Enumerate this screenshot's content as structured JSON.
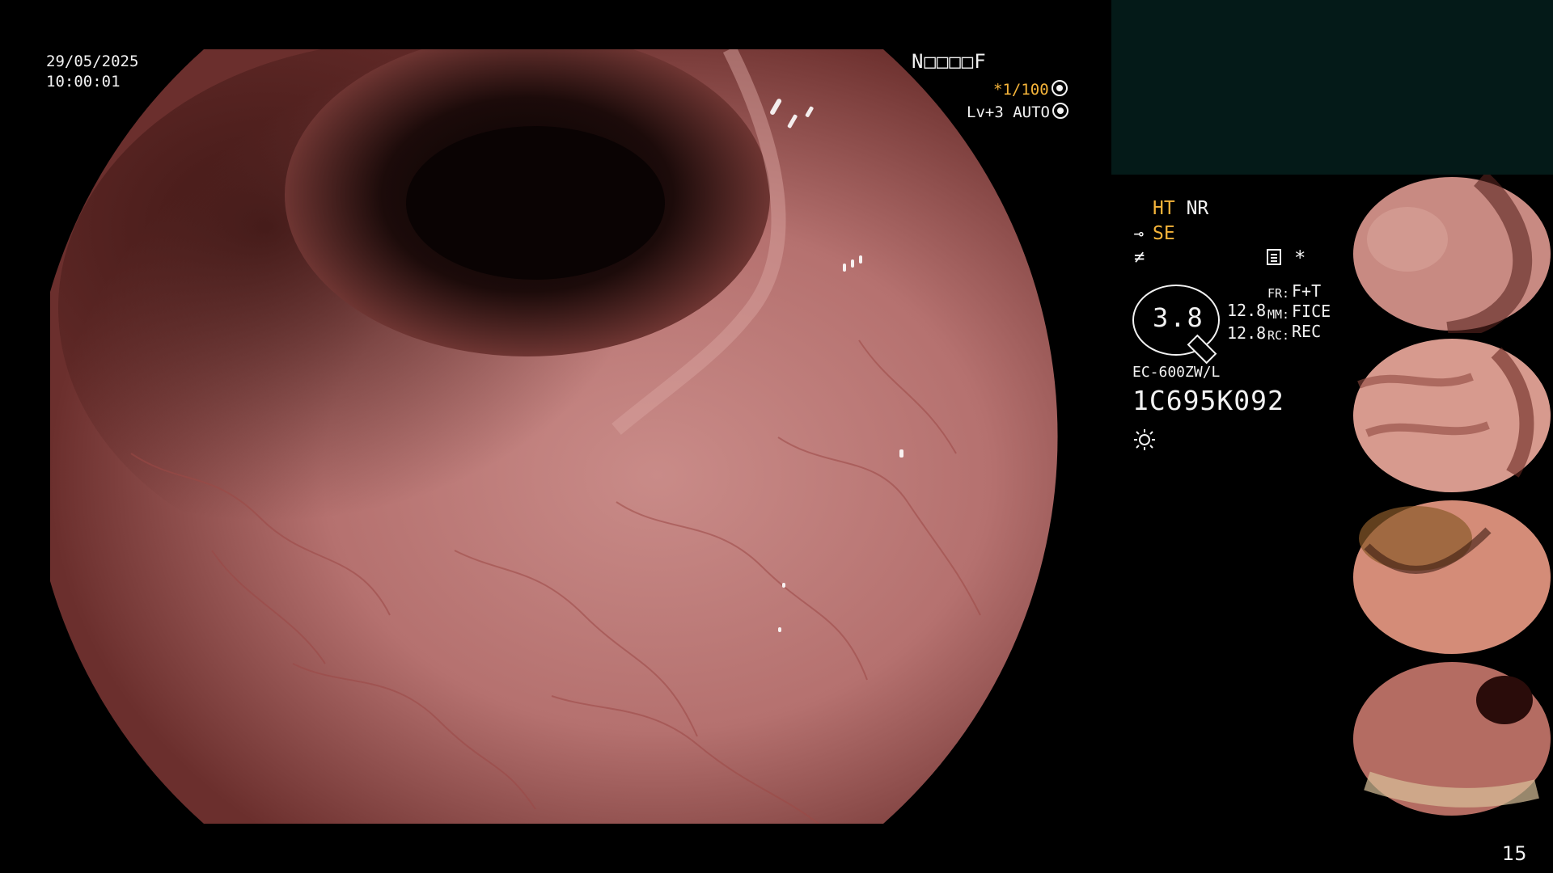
{
  "header": {
    "date": "29/05/2025",
    "time": "10:00:01",
    "patient_id": "N□□□□F",
    "shutter": "*1/100",
    "level": "Lv+3 AUTO"
  },
  "settings": {
    "ht_label": "HT",
    "nr_label": "NR",
    "se_label": "SE",
    "dial_value": "3.8",
    "fr_label": "FR:",
    "fr_value": "F+T",
    "mm_label": "MM:",
    "mm_value": "FICE",
    "rc_label": "RC:",
    "rc_value": "REC",
    "num_1": "12.8",
    "num_2": "12.8",
    "scope_model": "EC-600ZW/L",
    "serial": "1C695K092"
  },
  "footer": {
    "page_number": "15"
  },
  "colors": {
    "accent_orange": "#f5b43a",
    "panel_teal": "#041a18",
    "mucosa_pink": "#c98a8a"
  },
  "icons": [
    "shutter-icon",
    "auto-icon",
    "se-icon",
    "slash-icon",
    "document-icon",
    "asterisk-icon",
    "sun-icon"
  ]
}
